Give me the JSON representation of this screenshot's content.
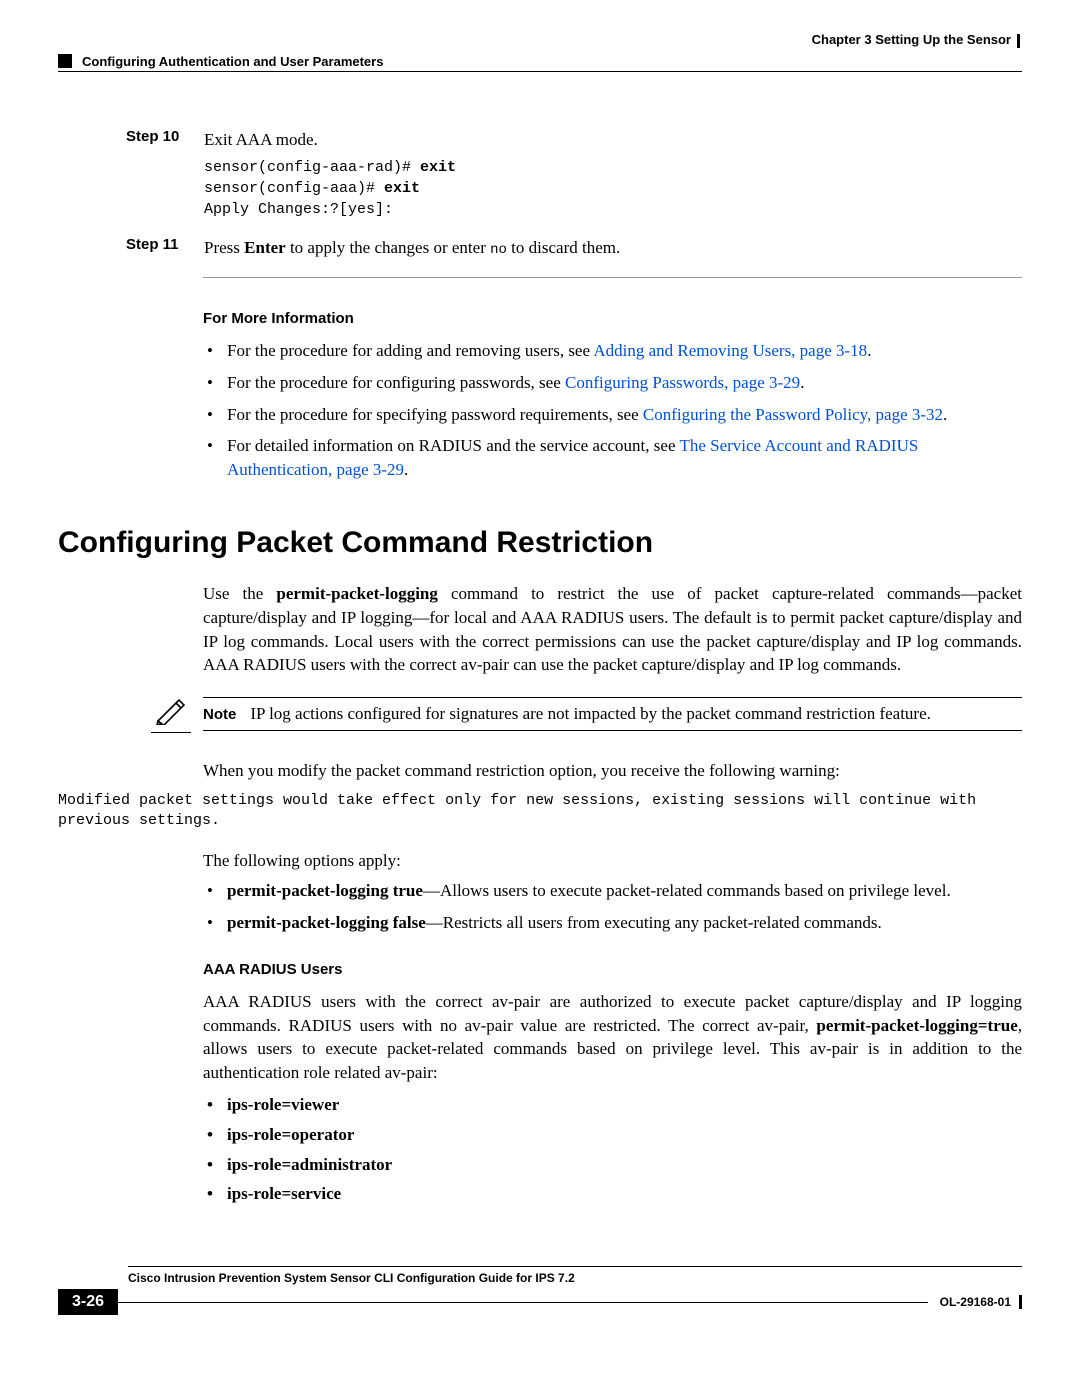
{
  "header": {
    "chapter": "Chapter 3      Setting Up the Sensor",
    "section": "Configuring Authentication and User Parameters"
  },
  "step10": {
    "label": "Step 10",
    "text": "Exit AAA mode.",
    "cli_line1_prompt": "sensor(config-aaa-rad)# ",
    "cli_line1_cmd": "exit",
    "cli_line2_prompt": "sensor(config-aaa)# ",
    "cli_line2_cmd": "exit",
    "cli_line3": "Apply Changes:?[yes]:"
  },
  "step11": {
    "label": "Step 11",
    "pre": "Press ",
    "enter": "Enter",
    "mid": " to apply the changes or enter ",
    "no": "no",
    "post": " to discard them."
  },
  "moreinfo": {
    "heading": "For More Information",
    "b1_pre": "For the procedure for adding and removing users, see ",
    "b1_link": "Adding and Removing Users, page 3-18",
    "b2_pre": "For the procedure for configuring passwords, see ",
    "b2_link": "Configuring Passwords, page 3-29",
    "b3_pre": "For the procedure for specifying password requirements, see ",
    "b3_link": "Configuring the Password Policy, page 3-32",
    "b4_pre": "For detailed information on RADIUS and the service account, see ",
    "b4_link": "The Service Account and RADIUS Authentication, page 3-29"
  },
  "h1": "Configuring Packet Command Restriction",
  "intro_pre": "Use the ",
  "intro_cmd": "permit-packet-logging",
  "intro_post": " command to restrict the use of packet capture-related commands—packet capture/display and IP logging—for local and AAA RADIUS users. The default is to permit packet capture/display and IP log commands. Local users with the correct permissions can use the packet capture/display and IP log commands. AAA RADIUS users with the correct av-pair can use the packet capture/display and IP log commands.",
  "note": {
    "label": "Note",
    "text": "IP log actions configured for signatures are not impacted by the packet command restriction feature."
  },
  "modify_line": "When you modify the packet command restriction option, you receive the following warning:",
  "warn_mono": "Modified packet settings would take effect only for new sessions, existing sessions will continue with previous settings.",
  "options_heading": "The following options apply:",
  "opt1_bold": "permit-packet-logging true",
  "opt1_rest": "—Allows users to execute packet-related commands based on privilege level.",
  "opt2_bold": "permit-packet-logging false",
  "opt2_rest": "—Restricts all users from executing any packet-related commands.",
  "aaa_heading": "AAA RADIUS Users",
  "aaa_p_pre": "AAA RADIUS users with the correct av-pair are authorized to execute packet capture/display and IP logging commands. RADIUS users with no av-pair value are restricted. The correct av-pair, ",
  "aaa_p_bold": "permit-packet-logging=true",
  "aaa_p_post": ", allows users to execute packet-related commands based on privilege level. This av-pair is in addition to the authentication role related av-pair:",
  "roles": {
    "r1": "ips-role=viewer",
    "r2": "ips-role=operator",
    "r3": "ips-role=administrator",
    "r4": "ips-role=service"
  },
  "footer": {
    "title": "Cisco Intrusion Prevention System Sensor CLI Configuration Guide for IPS 7.2",
    "page": "3-26",
    "docid": "OL-29168-01"
  }
}
